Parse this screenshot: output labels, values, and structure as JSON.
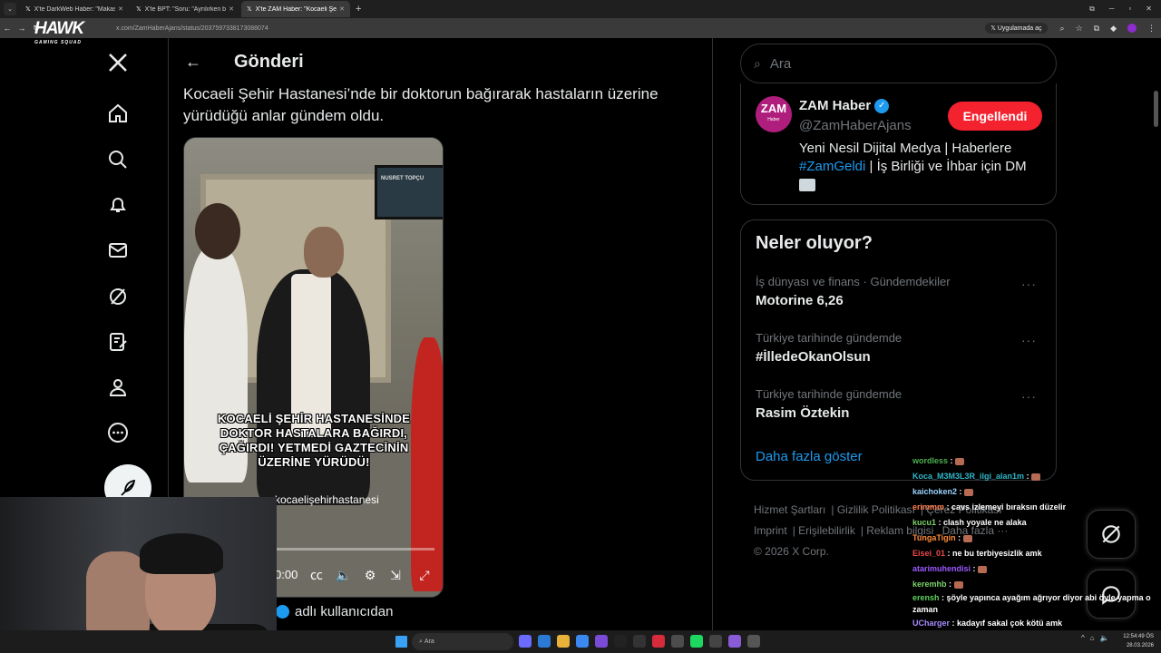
{
  "browser": {
    "tabs": [
      {
        "title": "X'te DarkWeb Haber: \"Makas al",
        "active": false
      },
      {
        "title": "X'te BPT: \"Soru: \"Ayrılırken bir",
        "active": false
      },
      {
        "title": "X'te ZAM Haber: \"Kocaeli Şehir",
        "active": true
      }
    ],
    "url": "x.com/ZamHaberAjans/status/2037597338173088074",
    "app_open_label": "Uygulamada aç"
  },
  "overlay_logo": {
    "main": "HAWK",
    "sub": "GAMING SQUAD"
  },
  "header": {
    "title": "Gönderi"
  },
  "tweet": {
    "text": "Kocaeli Şehir Hastanesi’nde bir doktorun bağırarak hastaların üzerine yürüdüğü anlar gündem oldu.",
    "video_caption": "KOCAELİ ŞEHİR HASTANESİNDE DOKTOR HASTALARA BAĞIRDI, ÇAĞIRDI! YETMEDİ GAZTECİNİN ÜZERİNE YÜRÜDÜ!",
    "video_handle": "kocaelişehirhastanesi",
    "video_time": "0:00",
    "tv_label": "NUSRET TOPÇU",
    "verified_label": "adlı kullanıcıdan"
  },
  "search": {
    "placeholder": "Ara"
  },
  "profile": {
    "avatar_text": "ZAM",
    "avatar_sub": "Haber",
    "name": "ZAM Haber",
    "handle": "@ZamHaberAjans",
    "blocked_label": "Engellendi",
    "bio_line1": "Yeni Nesil Dijital Medya | Haberlere",
    "bio_tag": "#ZamGeldi",
    "bio_line2_rest": " | İş Birliği ve İhbar için DM"
  },
  "trends": {
    "title": "Neler oluyor?",
    "items": [
      {
        "category": "İş dünyası ve finans · Gündemdekiler",
        "name": "Motorine 6,26"
      },
      {
        "category": "Türkiye tarihinde gündemde",
        "name": "#İlledeOkanOlsun"
      },
      {
        "category": "Türkiye tarihinde gündemde",
        "name": "Rasim Öztekin"
      }
    ],
    "show_more": "Daha fazla göster"
  },
  "footer": {
    "links": [
      "Hizmet Şartları",
      "Gizlilik Politikası",
      "Çerez Politikası",
      "Imprint",
      "Erişilebilirlik",
      "Reklam bilgisi",
      "Daha fazla ···"
    ],
    "copyright": "© 2026 X Corp."
  },
  "chat": [
    {
      "user": "wordless",
      "msg": "",
      "color": "#4caf50"
    },
    {
      "user": "Koca_M3M3L3R_ilgi_alan1m",
      "msg": "",
      "color": "#2fb6c9"
    },
    {
      "user": "kaichoken2",
      "msg": "",
      "color": "#9ad3ff"
    },
    {
      "user": "erimmm",
      "msg": "cavs izlemeyi bıraksın düzelir",
      "color": "#ff7f50"
    },
    {
      "user": "kucu1",
      "msg": "clash yoyale ne alaka",
      "color": "#7bd36b"
    },
    {
      "user": "TungaTigin",
      "msg": "",
      "color": "#ff8c3a"
    },
    {
      "user": "Eisei_01",
      "msg": "ne bu terbiyesizlik amk",
      "color": "#e84a4a"
    },
    {
      "user": "atarimuhendisi",
      "msg": "",
      "color": "#9b59ff"
    },
    {
      "user": "keremhb",
      "msg": "",
      "color": "#7bd36b"
    },
    {
      "user": "erensh",
      "msg": "şöyle yapınca ayağım ağrıyor diyor abi öyle yapma o zaman",
      "color": "#5fd35f"
    },
    {
      "user": "UCharger",
      "msg": "kadayıf sakal çok kötü amk",
      "color": "#a98bff"
    }
  ],
  "taskbar": {
    "search_placeholder": "Ara",
    "time": "12:54:49 ÖS",
    "date": "28.03.2026"
  },
  "colors": {
    "accent": "#1d9bf0",
    "danger": "#f4212e",
    "border": "#2f3336",
    "muted": "#71767b"
  }
}
